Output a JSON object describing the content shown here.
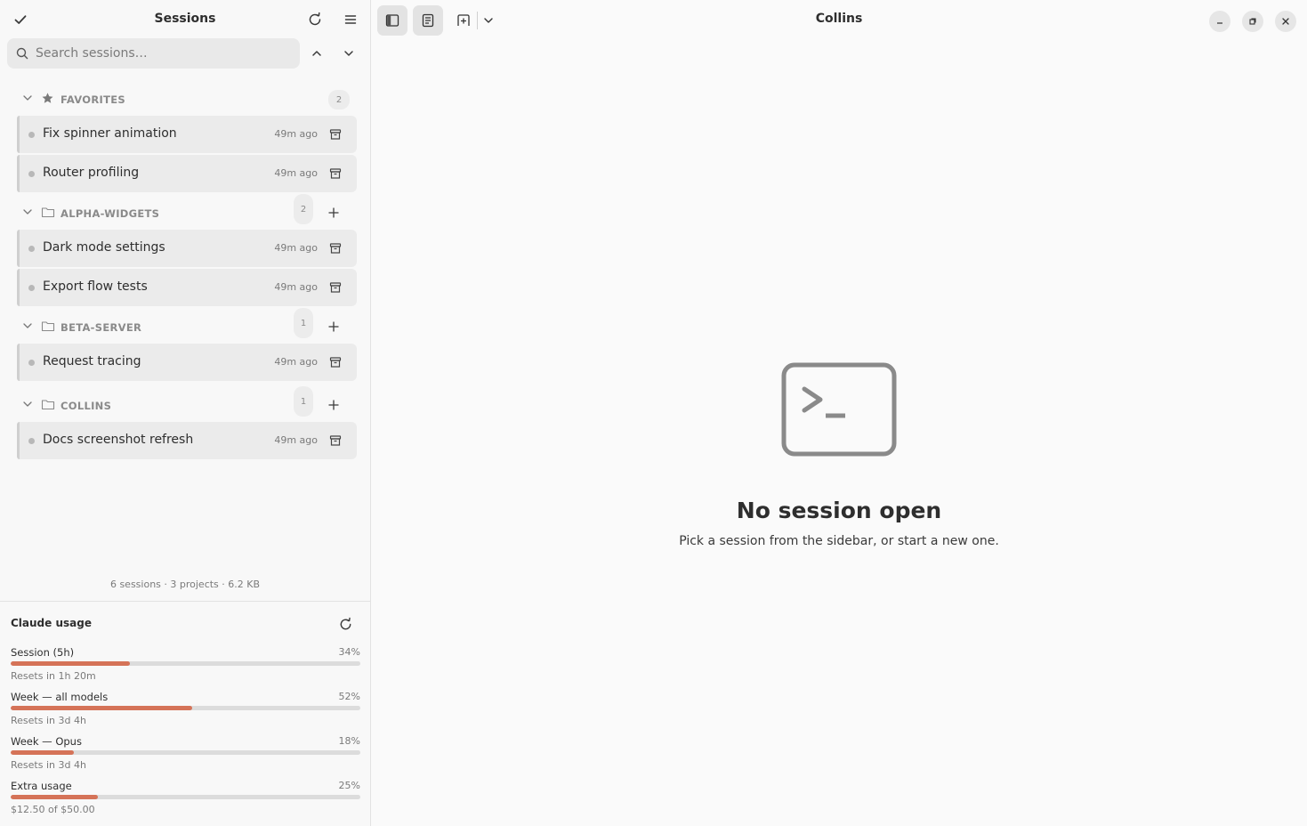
{
  "sidebar": {
    "title": "Sessions",
    "search_placeholder": "Search sessions…",
    "groups": [
      {
        "name": "FAVORITES",
        "count": "2",
        "icon": "star-icon",
        "sessions": [
          {
            "name": "Fix spinner animation",
            "time": "49m ago"
          },
          {
            "name": "Router profiling",
            "time": "49m ago"
          }
        ]
      },
      {
        "name": "ALPHA-WIDGETS",
        "count": "2",
        "icon": "folder-icon",
        "sessions": [
          {
            "name": "Dark mode settings",
            "time": "49m ago"
          },
          {
            "name": "Export flow tests",
            "time": "49m ago"
          }
        ]
      },
      {
        "name": "BETA-SERVER",
        "count": "1",
        "icon": "folder-icon",
        "sessions": [
          {
            "name": "Request tracing",
            "time": "49m ago"
          }
        ]
      },
      {
        "name": "COLLINS",
        "count": "1",
        "icon": "folder-icon",
        "sessions": [
          {
            "name": "Docs screenshot refresh",
            "time": "49m ago"
          }
        ]
      }
    ],
    "stats": "6 sessions · 3 projects · 6.2 KB"
  },
  "usage": {
    "title": "Claude usage",
    "meters": [
      {
        "label": "Session (5h)",
        "pct_label": "34%",
        "fraction": 0.34,
        "sub": "Resets in 1h 20m"
      },
      {
        "label": "Week — all models",
        "pct_label": "52%",
        "fraction": 0.52,
        "sub": "Resets in 3d 4h"
      },
      {
        "label": "Week — Opus",
        "pct_label": "18%",
        "fraction": 0.18,
        "sub": "Resets in 3d 4h"
      },
      {
        "label": "Extra usage",
        "pct_label": "25%",
        "fraction": 0.25,
        "sub": "$12.50 of $50.00"
      }
    ],
    "accent": "#d57358"
  },
  "main": {
    "window_title": "Collins",
    "empty_title": "No session open",
    "empty_subtitle": "Pick a session from the sidebar, or start a new one."
  }
}
